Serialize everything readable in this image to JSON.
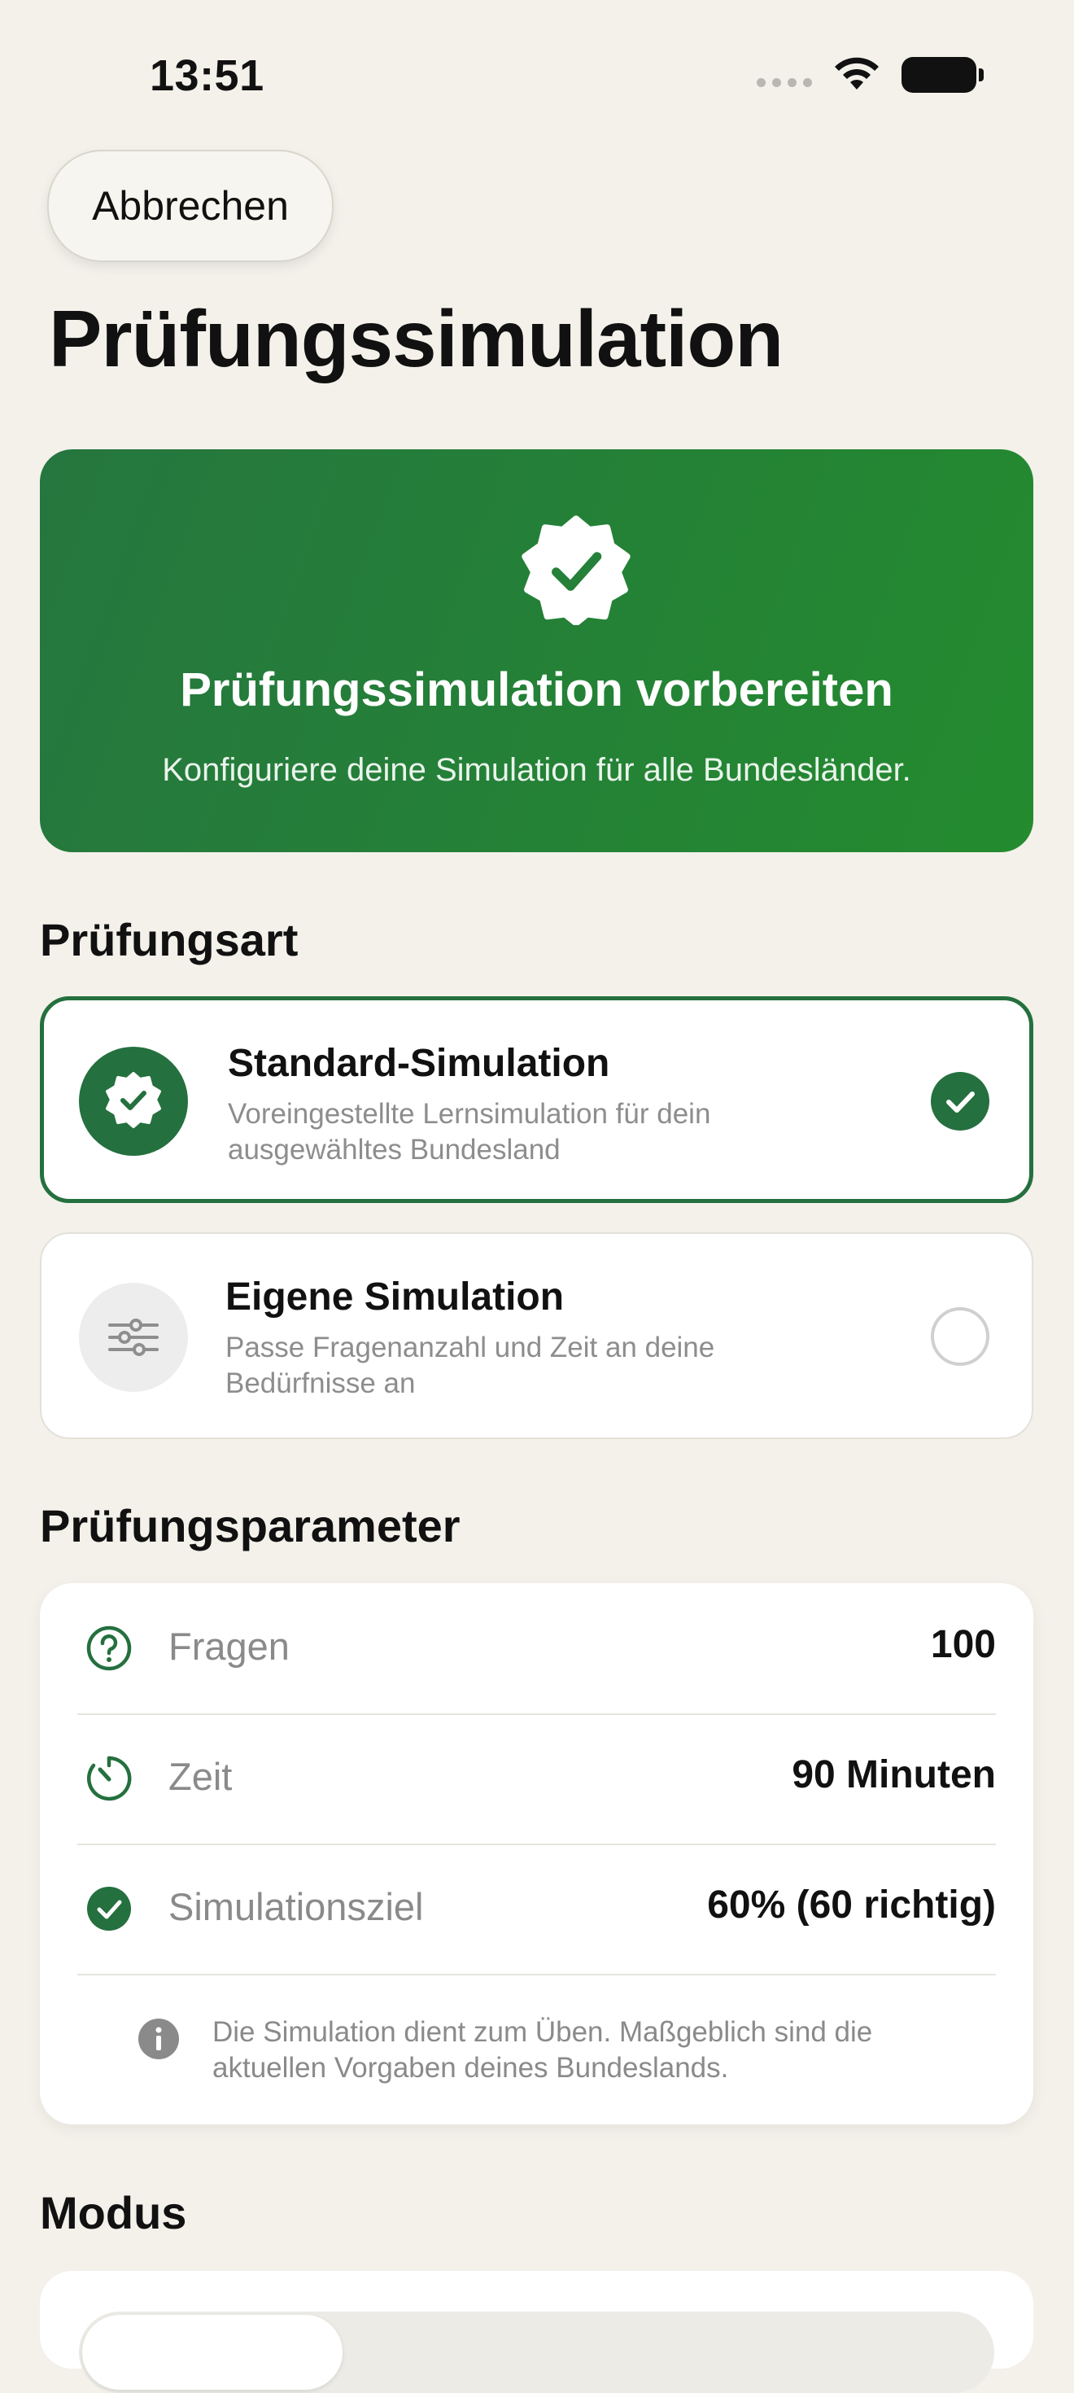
{
  "status_bar": {
    "time": "13:51",
    "icons": [
      "signal-dots-icon",
      "wifi-icon",
      "battery-icon"
    ]
  },
  "nav": {
    "cancel_label": "Abbrechen"
  },
  "page": {
    "title": "Prüfungssimulation"
  },
  "hero": {
    "icon": "checkmark-seal-icon",
    "title": "Prüfungssimulation vorbereiten",
    "subtitle": "Konfiguriere deine Simulation für alle Bundesländer.",
    "gradient_colors": [
      "#25763F",
      "#248B2F"
    ]
  },
  "exam_type": {
    "section_title": "Prüfungsart",
    "options": [
      {
        "title": "Standard-Simulation",
        "description": "Voreingestellte Lernsimulation für dein ausgewähltes Bundesland",
        "icon": "checkmark-seal-icon",
        "selected": true
      },
      {
        "title": "Eigene Simulation",
        "description": "Passe Fragenanzahl und Zeit an deine Bedürfnisse an",
        "icon": "sliders-icon",
        "selected": false
      }
    ]
  },
  "parameters": {
    "section_title": "Prüfungsparameter",
    "rows": [
      {
        "icon": "question-circle-icon",
        "label": "Fragen",
        "value": "100"
      },
      {
        "icon": "timer-icon",
        "label": "Zeit",
        "value": "90 Minuten"
      },
      {
        "icon": "checkmark-circle-icon",
        "label": "Simulationsziel",
        "value": "60% (60 richtig)"
      }
    ],
    "info_icon": "info-circle-icon",
    "info_text": "Die Simulation dient zum Üben. Maßgeblich sind die aktuellen Vorgaben deines Bundeslands."
  },
  "mode": {
    "section_title": "Modus"
  },
  "colors": {
    "accent": "#24703E",
    "background": "#F3F1EA",
    "secondary_text": "#8A8A8A"
  }
}
